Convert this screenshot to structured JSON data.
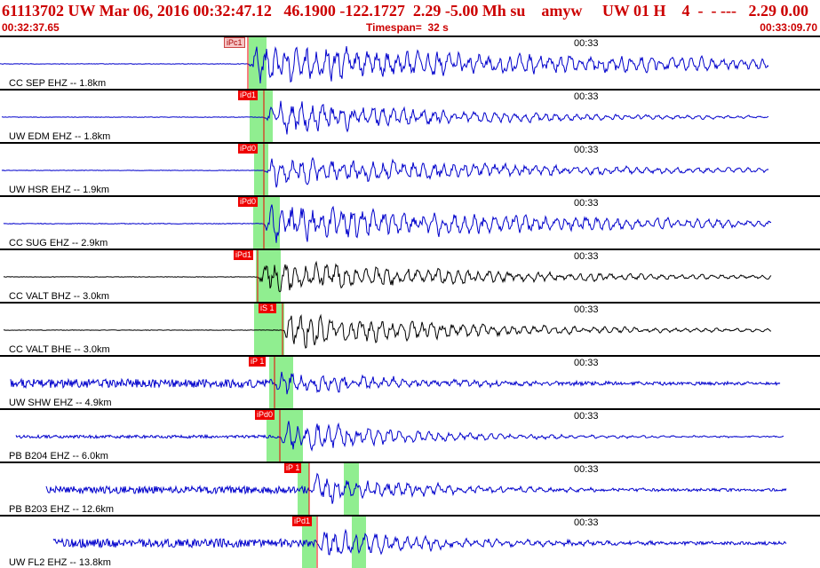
{
  "header": {
    "title": "61113702 UW Mar 06, 2016 00:32:47.12   46.1900 -122.1727  2.29 -5.00 Mh su    amyw     UW 01 H    4  -  - ---   2.29 0.00",
    "start_time": "00:32:37.65",
    "timespan": "Timespan=  32 s",
    "end_time": "00:33:09.70"
  },
  "colors": {
    "header_text": "#cc0000",
    "trace_blue": "#0000cc",
    "trace_black": "#000000",
    "pick_red": "#ee0000",
    "pick_window": "#90ee90"
  },
  "panels": [
    {
      "station": "CC SEP EHZ -- 1.8km",
      "tick": "00:33",
      "pick": "iPc1",
      "pick_style": "light",
      "color": "blue",
      "noise": 0.02,
      "amp": 1.0,
      "decay": 2.6
    },
    {
      "station": "UW EDM EHZ -- 1.8km",
      "tick": "00:33",
      "pick": "iPd1",
      "pick_style": "solid",
      "color": "blue",
      "noise": 0.02,
      "amp": 0.9,
      "decay": 1.2
    },
    {
      "station": "UW HSR EHZ -- 1.9km",
      "tick": "00:33",
      "pick": "iPd0",
      "pick_style": "solid",
      "color": "blue",
      "noise": 0.02,
      "amp": 0.8,
      "decay": 1.6
    },
    {
      "station": "CC SUG EHZ -- 2.9km",
      "tick": "00:33",
      "pick": "iPd0",
      "pick_style": "solid",
      "color": "blue",
      "noise": 0.03,
      "amp": 1.0,
      "decay": 1.9
    },
    {
      "station": "CC VALT BHZ -- 3.0km",
      "tick": "00:33",
      "pick": "iPd1",
      "pick_style": "solid",
      "color": "black",
      "noise": 0.02,
      "amp": 0.8,
      "decay": 1.5
    },
    {
      "station": "CC VALT BHE -- 3.0km",
      "tick": "00:33",
      "pick": "iS 1",
      "pick_style": "solid",
      "color": "black",
      "noise": 0.02,
      "amp": 0.9,
      "decay": 1.2
    },
    {
      "station": "UW SHW EHZ -- 4.9km",
      "tick": "00:33",
      "pick": "iP 1",
      "pick_style": "solid",
      "color": "blue",
      "noise": 0.35,
      "amp": 0.8,
      "decay": 0.7
    },
    {
      "station": "PB B204 EHZ -- 6.0km",
      "tick": "00:33",
      "pick": "iPd0",
      "pick_style": "solid",
      "color": "blue",
      "noise": 0.12,
      "amp": 0.85,
      "decay": 0.8
    },
    {
      "station": "PB B203 EHZ -- 12.6km",
      "tick": "00:33",
      "pick": "iP 1",
      "pick_style": "solid",
      "color": "blue",
      "noise": 0.3,
      "amp": 0.8,
      "decay": 0.7
    },
    {
      "station": "UW FL2 EHZ -- 13.8km",
      "tick": "00:33",
      "pick": "iPd1",
      "pick_style": "solid",
      "color": "blue",
      "noise": 0.35,
      "amp": 0.85,
      "decay": 0.7
    }
  ]
}
